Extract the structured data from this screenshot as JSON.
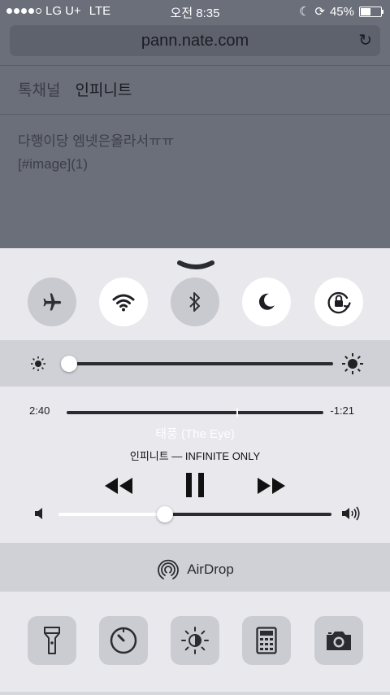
{
  "status_bar": {
    "carrier": "LG U+",
    "network": "LTE",
    "time": "오전 8:35",
    "battery": "45%"
  },
  "browser": {
    "url": "pann.nate.com",
    "tabs": [
      "톡채널",
      "인피니트"
    ],
    "post_lines": [
      "다행이당 엠넷은올라서ㅠㅠ",
      "[#image](1)"
    ]
  },
  "toggles": [
    {
      "icon": "airplane-icon",
      "state": "off"
    },
    {
      "icon": "wifi-icon",
      "state": "on"
    },
    {
      "icon": "bluetooth-icon",
      "state": "off"
    },
    {
      "icon": "moon-icon",
      "state": "on"
    },
    {
      "icon": "rotation-lock-icon",
      "state": "on"
    }
  ],
  "brightness": {
    "level": 0.02
  },
  "media": {
    "elapsed": "2:40",
    "remaining": "-1:21",
    "progress": 0.66,
    "song": "태풍 (The Eye)",
    "artist_album": "인피니트 — INFINITE ONLY",
    "volume": 0.39
  },
  "airdrop": {
    "label": "AirDrop"
  },
  "tools": [
    "flashlight-icon",
    "timer-icon",
    "night-shift-icon",
    "calculator-icon",
    "camera-icon"
  ]
}
